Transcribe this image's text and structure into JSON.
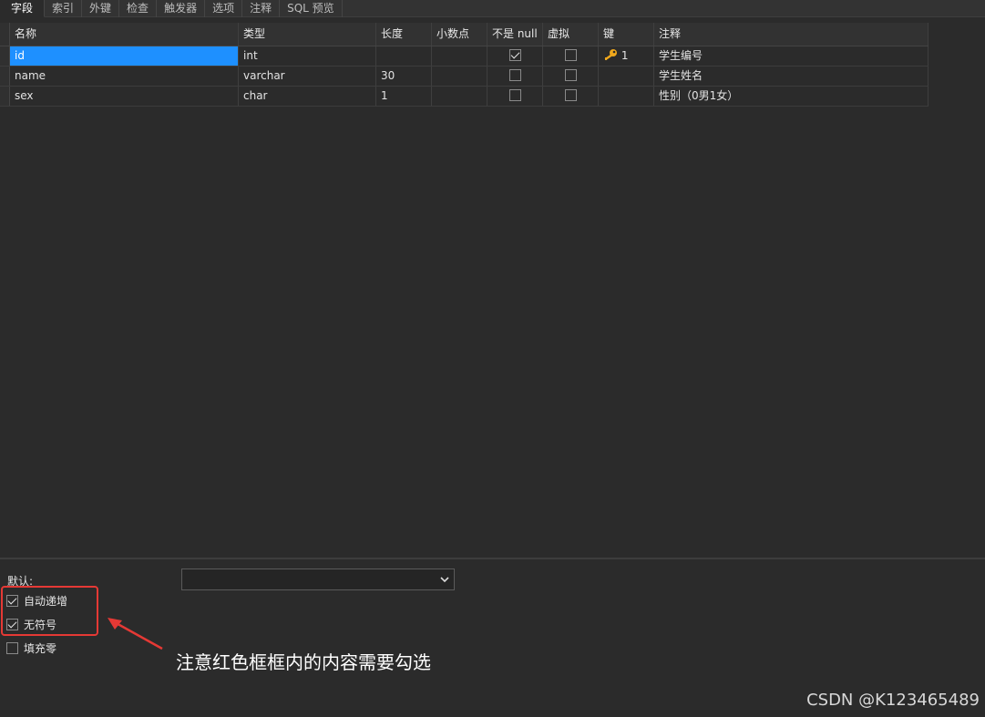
{
  "tabs": [
    "字段",
    "索引",
    "外键",
    "检查",
    "触发器",
    "选项",
    "注释",
    "SQL 预览"
  ],
  "columns": {
    "name": "名称",
    "type": "类型",
    "length": "长度",
    "decimals": "小数点",
    "not_null": "不是 null",
    "virtual": "虚拟",
    "key": "键",
    "comment": "注释"
  },
  "rows": [
    {
      "name": "id",
      "type": "int",
      "length": "",
      "decimals": "",
      "not_null": true,
      "virtual": false,
      "key": "1",
      "comment": "学生编号"
    },
    {
      "name": "name",
      "type": "varchar",
      "length": "30",
      "decimals": "",
      "not_null": false,
      "virtual": false,
      "key": "",
      "comment": "学生姓名"
    },
    {
      "name": "sex",
      "type": "char",
      "length": "1",
      "decimals": "",
      "not_null": false,
      "virtual": false,
      "key": "",
      "comment": "性别（0男1女）"
    }
  ],
  "bottom": {
    "default_label": "默认:",
    "default_value": "",
    "options": [
      {
        "label": "自动递增",
        "checked": true
      },
      {
        "label": "无符号",
        "checked": true
      },
      {
        "label": "填充零",
        "checked": false
      }
    ]
  },
  "annotation": "注意红色框框内的内容需要勾选",
  "watermark": "CSDN @K123465489",
  "colors": {
    "selection": "#1e90ff",
    "highlight_box": "#e53935",
    "key_icon": "#f0a81c"
  }
}
